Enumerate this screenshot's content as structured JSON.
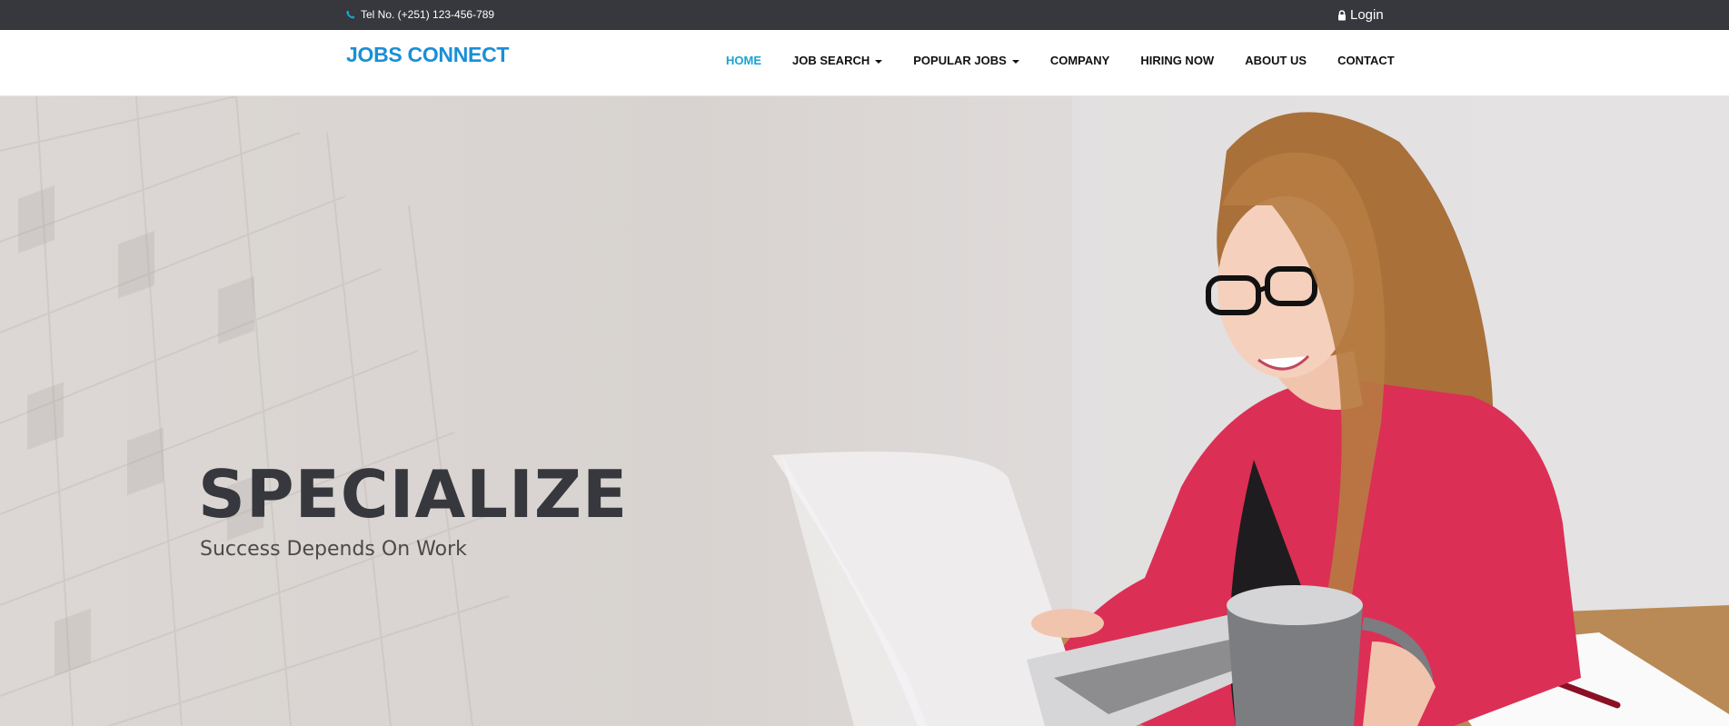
{
  "topbar": {
    "tel": "Tel No. (+251) 123-456-789",
    "login": "Login",
    "icons": {
      "phone": "phone-icon",
      "lock": "lock-icon"
    },
    "accent": "#19a3d0",
    "background": "#36383d"
  },
  "navbar": {
    "brand": "JOBS CONNECT",
    "brand_color": "#1a8fd6",
    "items": [
      {
        "label": "HOME",
        "active": true
      },
      {
        "label": "JOB SEARCH",
        "dropdown": true
      },
      {
        "label": "POPULAR JOBS",
        "dropdown": true
      },
      {
        "label": "COMPANY"
      },
      {
        "label": "HIRING NOW"
      },
      {
        "label": "ABOUT US"
      },
      {
        "label": "CONTACT"
      }
    ]
  },
  "hero": {
    "title": "SPECIALIZE",
    "subtitle": "Success Depends On Work"
  }
}
